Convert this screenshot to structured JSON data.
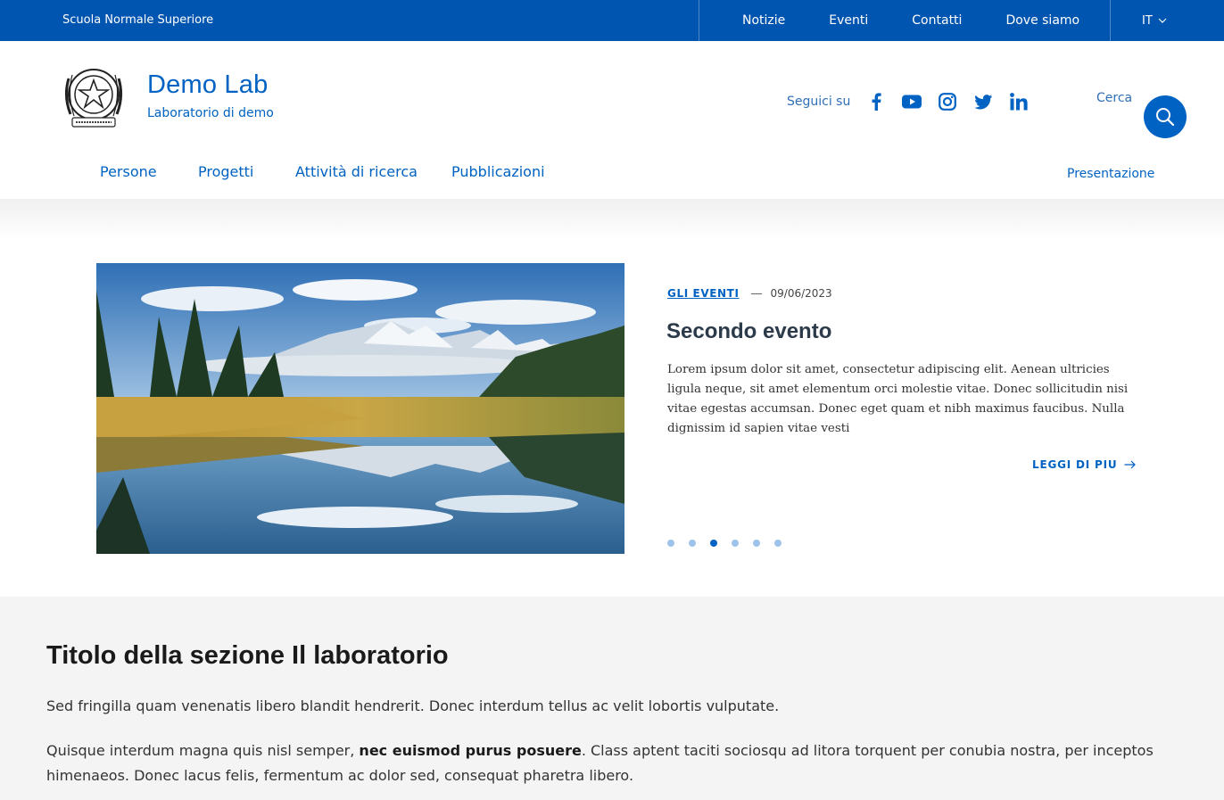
{
  "slim_header": {
    "brand": "Scuola Normale Superiore",
    "links": [
      "Notizie",
      "Eventi",
      "Contatti",
      "Dove siamo"
    ],
    "language": "IT"
  },
  "header": {
    "title": "Demo Lab",
    "subtitle": "Laboratorio di demo",
    "social_label": "Seguici su",
    "social_icons": [
      "facebook-icon",
      "youtube-icon",
      "instagram-icon",
      "twitter-icon",
      "linkedin-icon"
    ],
    "search_label": "Cerca"
  },
  "main_nav": {
    "items": [
      "Persone",
      "Progetti",
      "Attività di ricerca",
      "Pubblicazioni"
    ],
    "right_link": "Presentazione"
  },
  "carousel": {
    "category": "GLI EVENTI",
    "date": "09/06/2023",
    "title": "Secondo evento",
    "text": "Lorem ipsum dolor sit amet, consectetur adipiscing elit. Aenean ultricies ligula neque, sit amet elementum orci molestie vitae. Donec sollicitudin nisi vitae egestas accumsan. Donec eget quam et nibh maximus faucibus. Nulla dignissim id sapien vitae vesti",
    "read_more": "LEGGI DI PIU",
    "dot_count": 6,
    "active_dot": 3
  },
  "section": {
    "title": "Titolo della sezione Il laboratorio",
    "paragraph1": "Sed fringilla quam venenatis libero blandit hendrerit. Donec interdum tellus ac velit lobortis vulputate.",
    "paragraph2_pre": "Quisque interdum magna quis nisl semper, ",
    "paragraph2_bold": "nec euismod purus posuere",
    "paragraph2_post": ". Class aptent taciti sociosqu ad litora torquent per conubia nostra, per inceptos himenaeos. Donec lacus felis, fermentum ac dolor sed, consequat pharetra libero."
  },
  "colors": {
    "primary": "#0062c2",
    "slim_bg": "#0055b0",
    "section_bg": "#f4f4f4"
  }
}
